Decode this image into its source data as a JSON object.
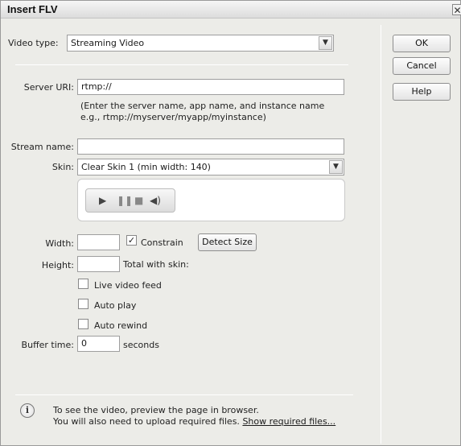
{
  "window": {
    "title": "Insert FLV",
    "close_glyph": "✕"
  },
  "video_type": {
    "label": "Video type:",
    "value": "Streaming Video"
  },
  "server_uri": {
    "label": "Server URI:",
    "value": "rtmp://",
    "hint_line1": "(Enter the server name, app name, and instance name",
    "hint_line2": "e.g., rtmp://myserver/myapp/myinstance)"
  },
  "stream_name": {
    "label": "Stream name:",
    "value": ""
  },
  "skin": {
    "label": "Skin:",
    "value": "Clear Skin 1 (min width: 140)",
    "controls": [
      "play-icon",
      "pause-icon",
      "stop-icon",
      "volume-icon"
    ]
  },
  "width": {
    "label": "Width:",
    "value": ""
  },
  "constrain": {
    "label": "Constrain",
    "checked": true
  },
  "detect_size_label": "Detect Size",
  "height": {
    "label": "Height:",
    "value": ""
  },
  "total_with_skin_label": "Total with skin:",
  "live_video_feed": {
    "label": "Live video feed",
    "checked": false
  },
  "auto_play": {
    "label": "Auto play",
    "checked": false
  },
  "auto_rewind": {
    "label": "Auto rewind",
    "checked": false
  },
  "buffer_time": {
    "label": "Buffer time:",
    "value": "0",
    "unit": "seconds"
  },
  "footer": {
    "line1": "To see the video, preview the page in browser.",
    "line2_prefix": "You will also need to upload required files.",
    "link": "Show required files..."
  },
  "buttons": {
    "ok": "OK",
    "cancel": "Cancel",
    "help": "Help"
  }
}
